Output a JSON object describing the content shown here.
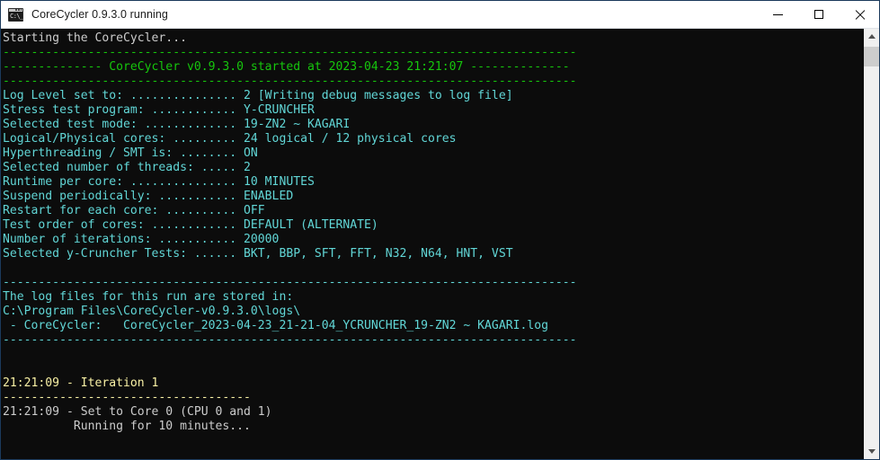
{
  "window": {
    "title": "CoreCycler 0.9.3.0 running",
    "icon": "console-icon",
    "controls": {
      "minimize": "minimize-button",
      "maximize": "maximize-button",
      "close": "close-button"
    }
  },
  "colors": {
    "background": "#0c0c0c",
    "white": "#cccccc",
    "green": "#16c60c",
    "cyan": "#61d6d6",
    "yellow": "#f9f1a5",
    "titlebar": "#ffffff",
    "border": "#1b3a5c"
  },
  "scrollbar": {
    "up_arrow": "scroll-up-arrow",
    "down_arrow": "scroll-down-arrow",
    "thumb": "scroll-thumb"
  },
  "console": {
    "lines": [
      {
        "text": "Starting the CoreCycler...",
        "color": "c-white"
      },
      {
        "text": "---------------------------------------------------------------------------------",
        "color": "c-green"
      },
      {
        "text": "-------------- CoreCycler v0.9.3.0 started at 2023-04-23 21:21:07 --------------",
        "color": "c-green"
      },
      {
        "text": "---------------------------------------------------------------------------------",
        "color": "c-green"
      },
      {
        "text": "Log Level set to: ............... 2 [Writing debug messages to log file]",
        "color": "c-cyanb"
      },
      {
        "text": "Stress test program: ............ Y-CRUNCHER",
        "color": "c-cyanb"
      },
      {
        "text": "Selected test mode: ............. 19-ZN2 ~ KAGARI",
        "color": "c-cyanb"
      },
      {
        "text": "Logical/Physical cores: ......... 24 logical / 12 physical cores",
        "color": "c-cyanb"
      },
      {
        "text": "Hyperthreading / SMT is: ........ ON",
        "color": "c-cyanb"
      },
      {
        "text": "Selected number of threads: ..... 2",
        "color": "c-cyanb"
      },
      {
        "text": "Runtime per core: ............... 10 MINUTES",
        "color": "c-cyanb"
      },
      {
        "text": "Suspend periodically: ........... ENABLED",
        "color": "c-cyanb"
      },
      {
        "text": "Restart for each core: .......... OFF",
        "color": "c-cyanb"
      },
      {
        "text": "Test order of cores: ............ DEFAULT (ALTERNATE)",
        "color": "c-cyanb"
      },
      {
        "text": "Number of iterations: ........... 20000",
        "color": "c-cyanb"
      },
      {
        "text": "Selected y-Cruncher Tests: ...... BKT, BBP, SFT, FFT, N32, N64, HNT, VST",
        "color": "c-cyanb"
      },
      {
        "text": "",
        "color": "blank"
      },
      {
        "text": "---------------------------------------------------------------------------------",
        "color": "c-cyanb"
      },
      {
        "text": "The log files for this run are stored in:",
        "color": "c-cyanb"
      },
      {
        "text": "C:\\Program Files\\CoreCycler-v0.9.3.0\\logs\\",
        "color": "c-cyanb"
      },
      {
        "text": " - CoreCycler:   CoreCycler_2023-04-23_21-21-04_YCRUNCHER_19-ZN2 ~ KAGARI.log",
        "color": "c-cyanb"
      },
      {
        "text": "---------------------------------------------------------------------------------",
        "color": "c-cyanb"
      },
      {
        "text": "",
        "color": "blank"
      },
      {
        "text": "",
        "color": "blank"
      },
      {
        "text": "21:21:09 - Iteration 1",
        "color": "c-yellow"
      },
      {
        "text": "-----------------------------------",
        "color": "c-yellow"
      },
      {
        "text": "21:21:09 - Set to Core 0 (CPU 0 and 1)",
        "color": "c-white"
      },
      {
        "text": "          Running for 10 minutes...",
        "color": "c-white"
      }
    ]
  }
}
